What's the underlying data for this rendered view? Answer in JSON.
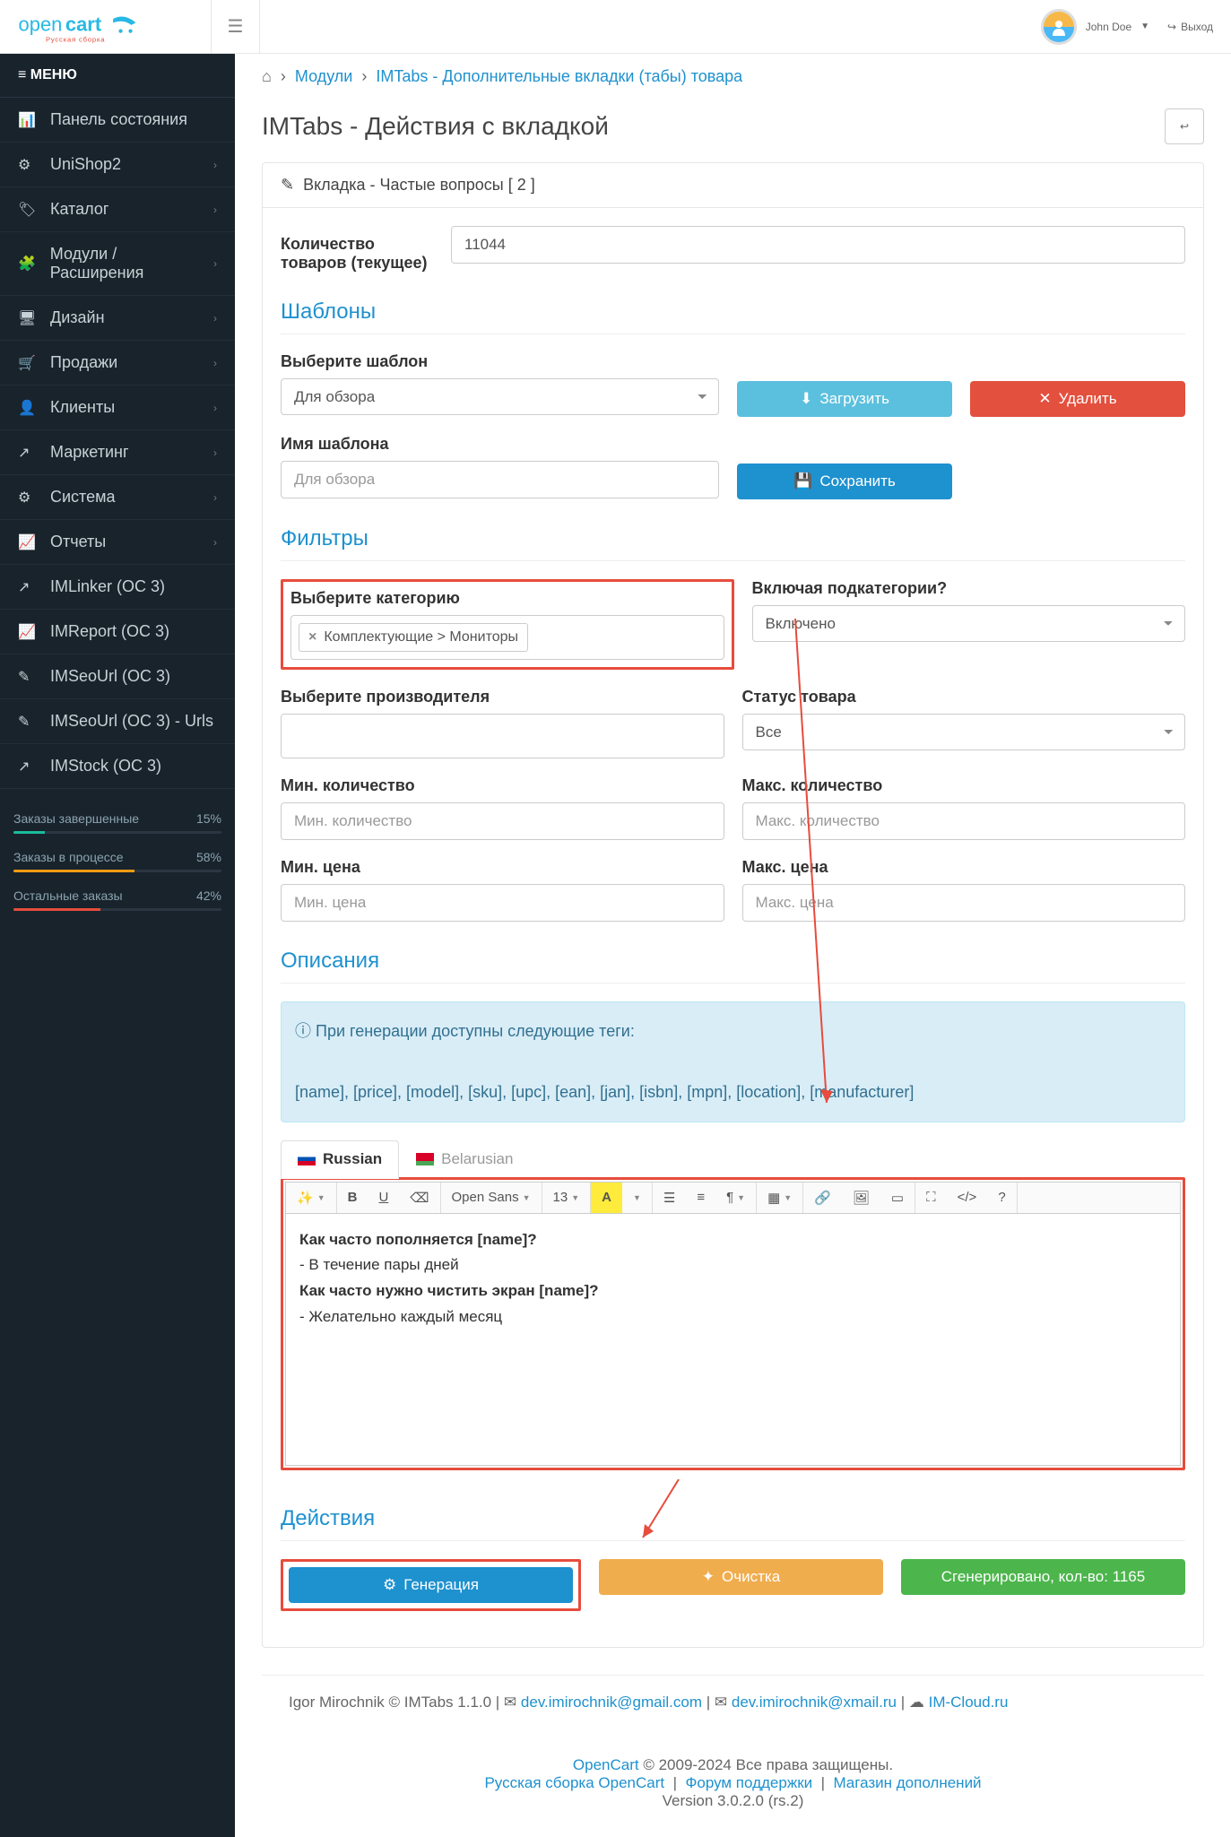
{
  "header": {
    "user_name": "John Doe",
    "logout": "Выход"
  },
  "sidebar": {
    "menu_title": "МЕНЮ",
    "items": [
      {
        "icon": "📊",
        "label": "Панель состояния",
        "chev": false
      },
      {
        "icon": "⚙",
        "label": "UniShop2",
        "chev": true
      },
      {
        "icon": "🏷",
        "label": "Каталог",
        "chev": true
      },
      {
        "icon": "🧩",
        "label": "Модули / Расширения",
        "chev": true
      },
      {
        "icon": "🖥",
        "label": "Дизайн",
        "chev": true
      },
      {
        "icon": "🛒",
        "label": "Продажи",
        "chev": true
      },
      {
        "icon": "👤",
        "label": "Клиенты",
        "chev": true
      },
      {
        "icon": "↗",
        "label": "Маркетинг",
        "chev": true
      },
      {
        "icon": "⚙",
        "label": "Система",
        "chev": true
      },
      {
        "icon": "📈",
        "label": "Отчеты",
        "chev": true
      },
      {
        "icon": "↗",
        "label": "IMLinker (OC 3)",
        "chev": false
      },
      {
        "icon": "📈",
        "label": "IMReport (OC 3)",
        "chev": false
      },
      {
        "icon": "✎",
        "label": "IMSeoUrl (OC 3)",
        "chev": false
      },
      {
        "icon": "✎",
        "label": "IMSeoUrl (OC 3) - Urls",
        "chev": false
      },
      {
        "icon": "↗",
        "label": "IMStock (OC 3)",
        "chev": false
      }
    ],
    "stats": [
      {
        "label": "Заказы завершенные",
        "pct": "15%",
        "width": 15,
        "color": "#1abc9c"
      },
      {
        "label": "Заказы в процессе",
        "pct": "58%",
        "width": 58,
        "color": "#f39c12"
      },
      {
        "label": "Остальные заказы",
        "pct": "42%",
        "width": 42,
        "color": "#e74c3c"
      }
    ]
  },
  "breadcrumb": {
    "modules": "Модули",
    "current": "IMTabs - Дополнительные вкладки (табы) товара"
  },
  "page_title": "IMTabs - Действия с вкладкой",
  "tab_heading": "Вкладка - Частые вопросы [ 2 ]",
  "product_count": {
    "label": "Количество товаров (текущее)",
    "value": "11044"
  },
  "templates": {
    "legend": "Шаблоны",
    "select_label": "Выберите шаблон",
    "select_value": "Для обзора",
    "load_btn": "Загрузить",
    "delete_btn": "Удалить",
    "name_label": "Имя шаблона",
    "name_placeholder": "Для обзора",
    "save_btn": "Сохранить"
  },
  "filters": {
    "legend": "Фильтры",
    "category_label": "Выберите категорию",
    "category_token": "Комплектующие > Мониторы",
    "include_sub_label": "Включая подкатегории?",
    "include_sub_value": "Включено",
    "manufacturer_label": "Выберите производителя",
    "status_label": "Статус товара",
    "status_value": "Все",
    "min_qty_label": "Мин. количество",
    "min_qty_placeholder": "Мин. количество",
    "max_qty_label": "Макс. количество",
    "max_qty_placeholder": "Макс. количество",
    "min_price_label": "Мин. цена",
    "min_price_placeholder": "Мин. цена",
    "max_price_label": "Макс. цена",
    "max_price_placeholder": "Макс. цена"
  },
  "descriptions": {
    "legend": "Описания",
    "info_line1": "При генерации доступны следующие теги:",
    "info_line2": "[name], [price], [model], [sku], [upc], [ean], [jan], [isbn], [mpn], [location], [manufacturer]",
    "tab_ru": "Russian",
    "tab_be": "Belarusian",
    "font_name": "Open Sans",
    "font_size": "13",
    "content": {
      "q1": "Как часто пополняется [name]?",
      "a1": "- В течение пары дней",
      "q2": "Как часто нужно чистить экран [name]?",
      "a2": "- Желательно каждый месяц"
    }
  },
  "actions": {
    "legend": "Действия",
    "generate": "Генерация",
    "cleanup": "Очистка",
    "generated": "Сгенерировано, кол-во: 1165"
  },
  "footer": {
    "copyright": "Igor Mirochnik © IMTabs 1.1.0",
    "email1": "dev.imirochnik@gmail.com",
    "email2": "dev.imirochnik@xmail.ru",
    "site": "IM-Cloud.ru"
  },
  "bottom": {
    "opencart": "OpenCart",
    "rights": " © 2009-2024 Все права защищены.",
    "link1": "Русская сборка OpenCart",
    "link2": "Форум поддержки",
    "link3": "Магазин дополнений",
    "version": "Version 3.0.2.0 (rs.2)"
  }
}
